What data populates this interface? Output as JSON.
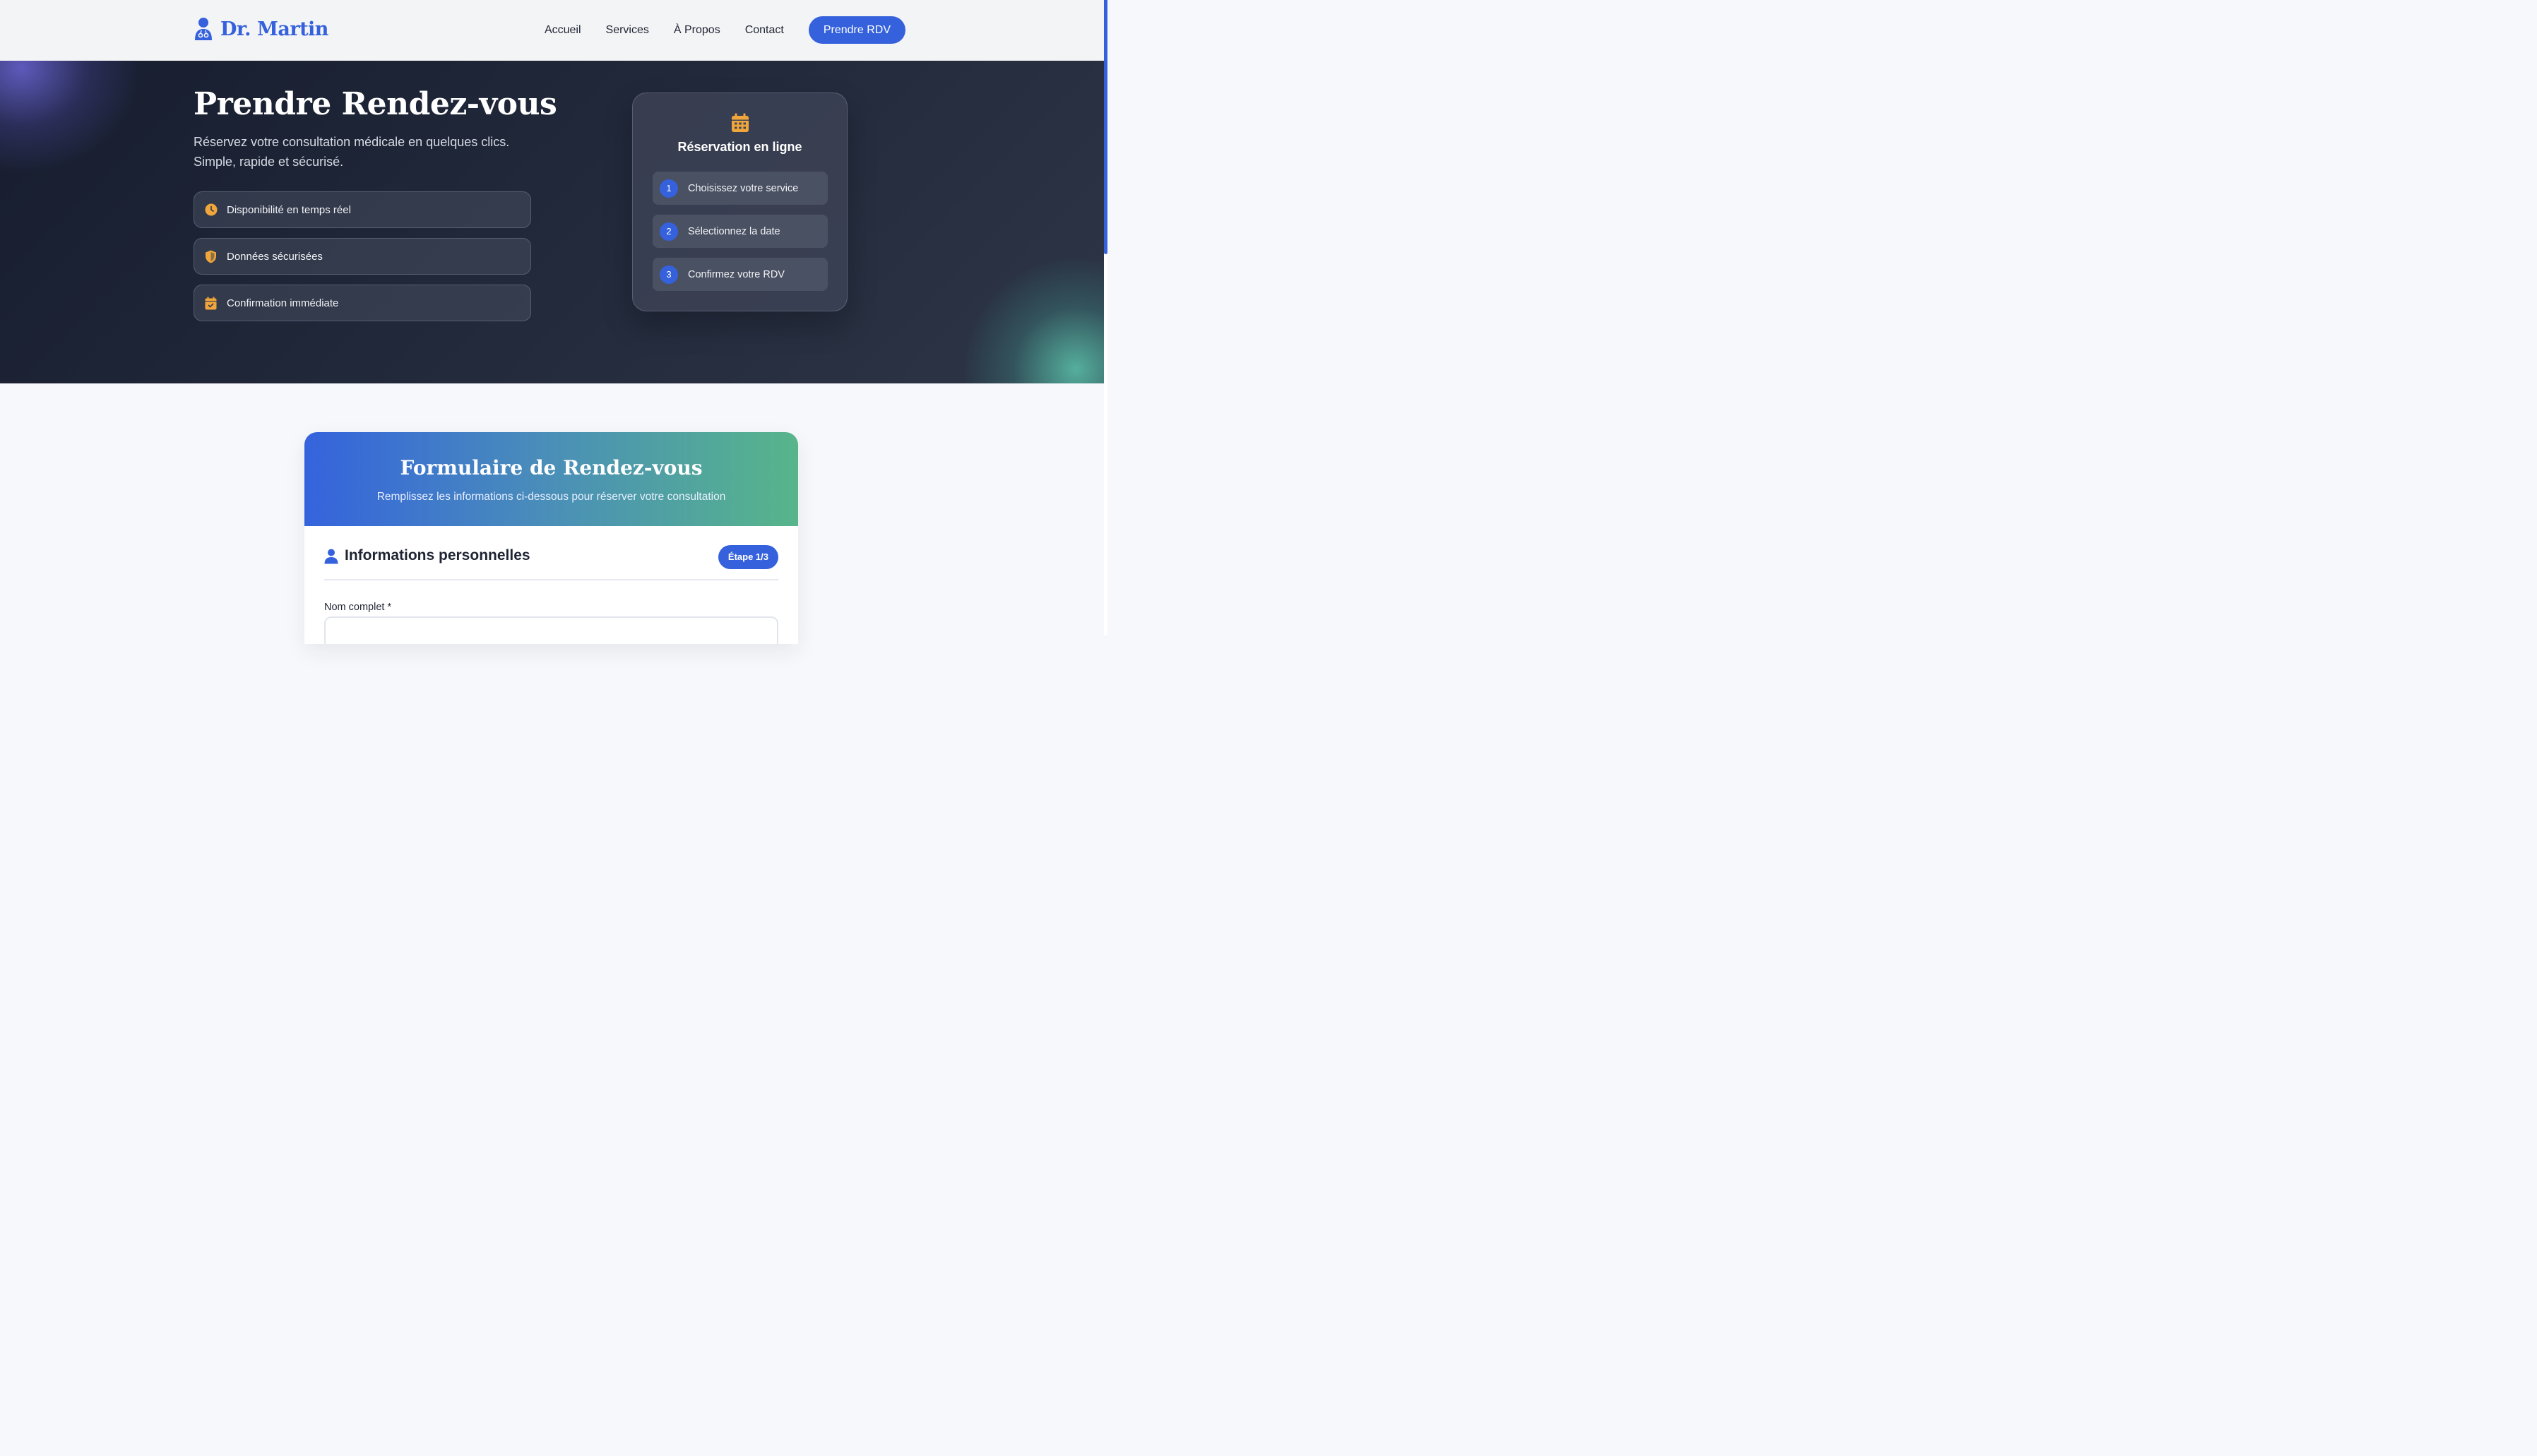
{
  "header": {
    "brand": "Dr. Martin",
    "nav": [
      "Accueil",
      "Services",
      "À Propos",
      "Contact"
    ],
    "cta": "Prendre RDV"
  },
  "hero": {
    "title": "Prendre Rendez-vous",
    "subtitle": "Réservez votre consultation médicale en quelques clics. Simple, rapide et sécurisé.",
    "features": [
      {
        "icon": "clock-icon",
        "label": "Disponibilité en temps réel"
      },
      {
        "icon": "shield-icon",
        "label": "Données sécurisées"
      },
      {
        "icon": "calendar-check-icon",
        "label": "Confirmation immédiate"
      }
    ],
    "card": {
      "icon": "calendar-icon",
      "title": "Réservation en ligne",
      "steps": [
        {
          "num": "1",
          "label": "Choisissez votre service"
        },
        {
          "num": "2",
          "label": "Sélectionnez la date"
        },
        {
          "num": "3",
          "label": "Confirmez votre RDV"
        }
      ]
    }
  },
  "form": {
    "title": "Formulaire de Rendez-vous",
    "subtitle": "Remplissez les informations ci-dessous pour réserver votre consultation",
    "section_title": "Informations personnelles",
    "step_badge": "Étape 1/3",
    "name_label": "Nom complet *",
    "name_value": ""
  },
  "colors": {
    "primary": "#3561dc",
    "accent": "#f0a63a",
    "hero_bg": "#1b2133",
    "gradient_end": "#57b58a"
  }
}
